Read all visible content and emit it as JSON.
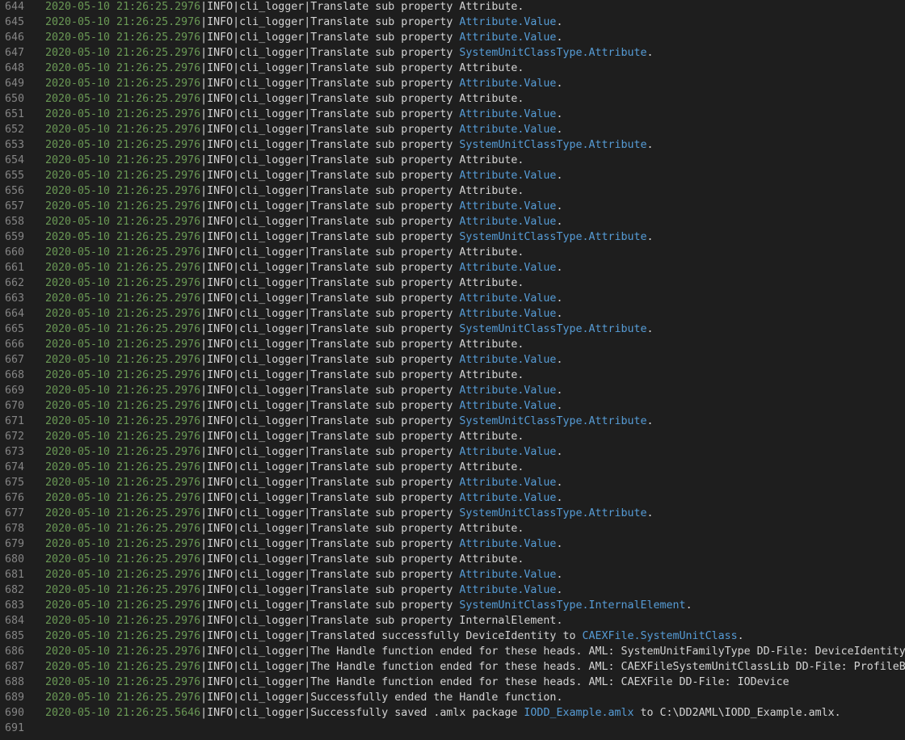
{
  "lines": [
    {
      "num": "644",
      "ts": "2020-05-10 21:26:25.2976",
      "msg": "|INFO|cli_logger|Translate sub property ",
      "link": "",
      "tail": "Attribute."
    },
    {
      "num": "645",
      "ts": "2020-05-10 21:26:25.2976",
      "msg": "|INFO|cli_logger|Translate sub property ",
      "link": "Attribute.Value",
      "tail": "."
    },
    {
      "num": "646",
      "ts": "2020-05-10 21:26:25.2976",
      "msg": "|INFO|cli_logger|Translate sub property ",
      "link": "Attribute.Value",
      "tail": "."
    },
    {
      "num": "647",
      "ts": "2020-05-10 21:26:25.2976",
      "msg": "|INFO|cli_logger|Translate sub property ",
      "link": "SystemUnitClassType.Attribute",
      "tail": "."
    },
    {
      "num": "648",
      "ts": "2020-05-10 21:26:25.2976",
      "msg": "|INFO|cli_logger|Translate sub property ",
      "link": "",
      "tail": "Attribute."
    },
    {
      "num": "649",
      "ts": "2020-05-10 21:26:25.2976",
      "msg": "|INFO|cli_logger|Translate sub property ",
      "link": "Attribute.Value",
      "tail": "."
    },
    {
      "num": "650",
      "ts": "2020-05-10 21:26:25.2976",
      "msg": "|INFO|cli_logger|Translate sub property ",
      "link": "",
      "tail": "Attribute."
    },
    {
      "num": "651",
      "ts": "2020-05-10 21:26:25.2976",
      "msg": "|INFO|cli_logger|Translate sub property ",
      "link": "Attribute.Value",
      "tail": "."
    },
    {
      "num": "652",
      "ts": "2020-05-10 21:26:25.2976",
      "msg": "|INFO|cli_logger|Translate sub property ",
      "link": "Attribute.Value",
      "tail": "."
    },
    {
      "num": "653",
      "ts": "2020-05-10 21:26:25.2976",
      "msg": "|INFO|cli_logger|Translate sub property ",
      "link": "SystemUnitClassType.Attribute",
      "tail": "."
    },
    {
      "num": "654",
      "ts": "2020-05-10 21:26:25.2976",
      "msg": "|INFO|cli_logger|Translate sub property ",
      "link": "",
      "tail": "Attribute."
    },
    {
      "num": "655",
      "ts": "2020-05-10 21:26:25.2976",
      "msg": "|INFO|cli_logger|Translate sub property ",
      "link": "Attribute.Value",
      "tail": "."
    },
    {
      "num": "656",
      "ts": "2020-05-10 21:26:25.2976",
      "msg": "|INFO|cli_logger|Translate sub property ",
      "link": "",
      "tail": "Attribute."
    },
    {
      "num": "657",
      "ts": "2020-05-10 21:26:25.2976",
      "msg": "|INFO|cli_logger|Translate sub property ",
      "link": "Attribute.Value",
      "tail": "."
    },
    {
      "num": "658",
      "ts": "2020-05-10 21:26:25.2976",
      "msg": "|INFO|cli_logger|Translate sub property ",
      "link": "Attribute.Value",
      "tail": "."
    },
    {
      "num": "659",
      "ts": "2020-05-10 21:26:25.2976",
      "msg": "|INFO|cli_logger|Translate sub property ",
      "link": "SystemUnitClassType.Attribute",
      "tail": "."
    },
    {
      "num": "660",
      "ts": "2020-05-10 21:26:25.2976",
      "msg": "|INFO|cli_logger|Translate sub property ",
      "link": "",
      "tail": "Attribute."
    },
    {
      "num": "661",
      "ts": "2020-05-10 21:26:25.2976",
      "msg": "|INFO|cli_logger|Translate sub property ",
      "link": "Attribute.Value",
      "tail": "."
    },
    {
      "num": "662",
      "ts": "2020-05-10 21:26:25.2976",
      "msg": "|INFO|cli_logger|Translate sub property ",
      "link": "",
      "tail": "Attribute."
    },
    {
      "num": "663",
      "ts": "2020-05-10 21:26:25.2976",
      "msg": "|INFO|cli_logger|Translate sub property ",
      "link": "Attribute.Value",
      "tail": "."
    },
    {
      "num": "664",
      "ts": "2020-05-10 21:26:25.2976",
      "msg": "|INFO|cli_logger|Translate sub property ",
      "link": "Attribute.Value",
      "tail": "."
    },
    {
      "num": "665",
      "ts": "2020-05-10 21:26:25.2976",
      "msg": "|INFO|cli_logger|Translate sub property ",
      "link": "SystemUnitClassType.Attribute",
      "tail": "."
    },
    {
      "num": "666",
      "ts": "2020-05-10 21:26:25.2976",
      "msg": "|INFO|cli_logger|Translate sub property ",
      "link": "",
      "tail": "Attribute."
    },
    {
      "num": "667",
      "ts": "2020-05-10 21:26:25.2976",
      "msg": "|INFO|cli_logger|Translate sub property ",
      "link": "Attribute.Value",
      "tail": "."
    },
    {
      "num": "668",
      "ts": "2020-05-10 21:26:25.2976",
      "msg": "|INFO|cli_logger|Translate sub property ",
      "link": "",
      "tail": "Attribute."
    },
    {
      "num": "669",
      "ts": "2020-05-10 21:26:25.2976",
      "msg": "|INFO|cli_logger|Translate sub property ",
      "link": "Attribute.Value",
      "tail": "."
    },
    {
      "num": "670",
      "ts": "2020-05-10 21:26:25.2976",
      "msg": "|INFO|cli_logger|Translate sub property ",
      "link": "Attribute.Value",
      "tail": "."
    },
    {
      "num": "671",
      "ts": "2020-05-10 21:26:25.2976",
      "msg": "|INFO|cli_logger|Translate sub property ",
      "link": "SystemUnitClassType.Attribute",
      "tail": "."
    },
    {
      "num": "672",
      "ts": "2020-05-10 21:26:25.2976",
      "msg": "|INFO|cli_logger|Translate sub property ",
      "link": "",
      "tail": "Attribute."
    },
    {
      "num": "673",
      "ts": "2020-05-10 21:26:25.2976",
      "msg": "|INFO|cli_logger|Translate sub property ",
      "link": "Attribute.Value",
      "tail": "."
    },
    {
      "num": "674",
      "ts": "2020-05-10 21:26:25.2976",
      "msg": "|INFO|cli_logger|Translate sub property ",
      "link": "",
      "tail": "Attribute."
    },
    {
      "num": "675",
      "ts": "2020-05-10 21:26:25.2976",
      "msg": "|INFO|cli_logger|Translate sub property ",
      "link": "Attribute.Value",
      "tail": "."
    },
    {
      "num": "676",
      "ts": "2020-05-10 21:26:25.2976",
      "msg": "|INFO|cli_logger|Translate sub property ",
      "link": "Attribute.Value",
      "tail": "."
    },
    {
      "num": "677",
      "ts": "2020-05-10 21:26:25.2976",
      "msg": "|INFO|cli_logger|Translate sub property ",
      "link": "SystemUnitClassType.Attribute",
      "tail": "."
    },
    {
      "num": "678",
      "ts": "2020-05-10 21:26:25.2976",
      "msg": "|INFO|cli_logger|Translate sub property ",
      "link": "",
      "tail": "Attribute."
    },
    {
      "num": "679",
      "ts": "2020-05-10 21:26:25.2976",
      "msg": "|INFO|cli_logger|Translate sub property ",
      "link": "Attribute.Value",
      "tail": "."
    },
    {
      "num": "680",
      "ts": "2020-05-10 21:26:25.2976",
      "msg": "|INFO|cli_logger|Translate sub property ",
      "link": "",
      "tail": "Attribute."
    },
    {
      "num": "681",
      "ts": "2020-05-10 21:26:25.2976",
      "msg": "|INFO|cli_logger|Translate sub property ",
      "link": "Attribute.Value",
      "tail": "."
    },
    {
      "num": "682",
      "ts": "2020-05-10 21:26:25.2976",
      "msg": "|INFO|cli_logger|Translate sub property ",
      "link": "Attribute.Value",
      "tail": "."
    },
    {
      "num": "683",
      "ts": "2020-05-10 21:26:25.2976",
      "msg": "|INFO|cli_logger|Translate sub property ",
      "link": "SystemUnitClassType.InternalElement",
      "tail": "."
    },
    {
      "num": "684",
      "ts": "2020-05-10 21:26:25.2976",
      "msg": "|INFO|cli_logger|Translate sub property ",
      "link": "",
      "tail": "InternalElement."
    },
    {
      "num": "685",
      "ts": "2020-05-10 21:26:25.2976",
      "msg": "|INFO|cli_logger|Translated successfully DeviceIdentity to ",
      "link": "CAEXFile.SystemUnitClass",
      "tail": "."
    },
    {
      "num": "686",
      "ts": "2020-05-10 21:26:25.2976",
      "msg": "|INFO|cli_logger|The Handle function ended for these heads. AML: SystemUnitFamilyType DD-File: DeviceIdentity",
      "link": "",
      "tail": ""
    },
    {
      "num": "687",
      "ts": "2020-05-10 21:26:25.2976",
      "msg": "|INFO|cli_logger|The Handle function ended for these heads. AML: CAEXFileSystemUnitClassLib DD-File: ProfileBody",
      "link": "",
      "tail": ""
    },
    {
      "num": "688",
      "ts": "2020-05-10 21:26:25.2976",
      "msg": "|INFO|cli_logger|The Handle function ended for these heads. AML: CAEXFile DD-File: IODevice",
      "link": "",
      "tail": ""
    },
    {
      "num": "689",
      "ts": "2020-05-10 21:26:25.2976",
      "msg": "|INFO|cli_logger|Successfully ended the Handle function.",
      "link": "",
      "tail": ""
    },
    {
      "num": "690",
      "ts": "2020-05-10 21:26:25.5646",
      "msg": "|INFO|cli_logger|Successfully saved .amlx package ",
      "link": "IODD_Example.amlx",
      "tail": " to C:\\DD2AML\\IODD_Example.amlx."
    },
    {
      "num": "691",
      "ts": "",
      "msg": "",
      "link": "",
      "tail": ""
    }
  ],
  "colors": {
    "background": "#1e1e1e",
    "line_number": "#858585",
    "timestamp": "#6a9955",
    "text": "#d4d4d4",
    "highlight": "#569cd6"
  }
}
